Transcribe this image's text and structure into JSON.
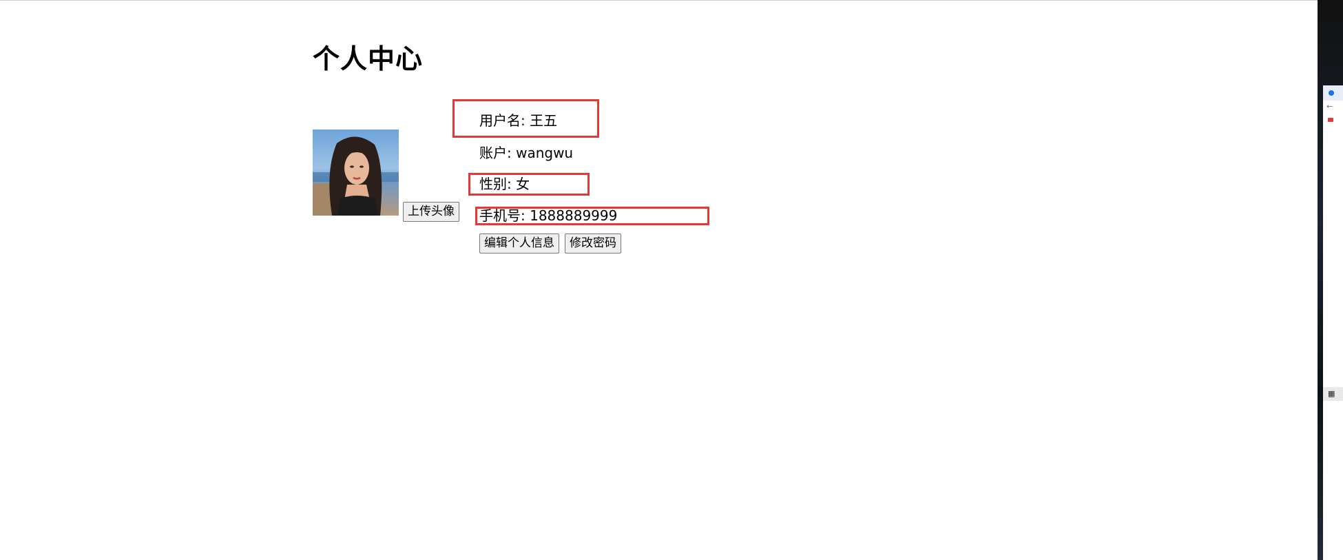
{
  "page": {
    "title": "个人中心"
  },
  "avatar": {
    "upload_label": "上传头像"
  },
  "profile": {
    "username": "用户名: 王五",
    "account": "账户: wangwu",
    "gender": "性别: 女",
    "phone": "手机号: 1888889999"
  },
  "actions": {
    "edit_label": "编辑个人信息",
    "password_label": "修改密码"
  },
  "highlight_color": "#e53935"
}
